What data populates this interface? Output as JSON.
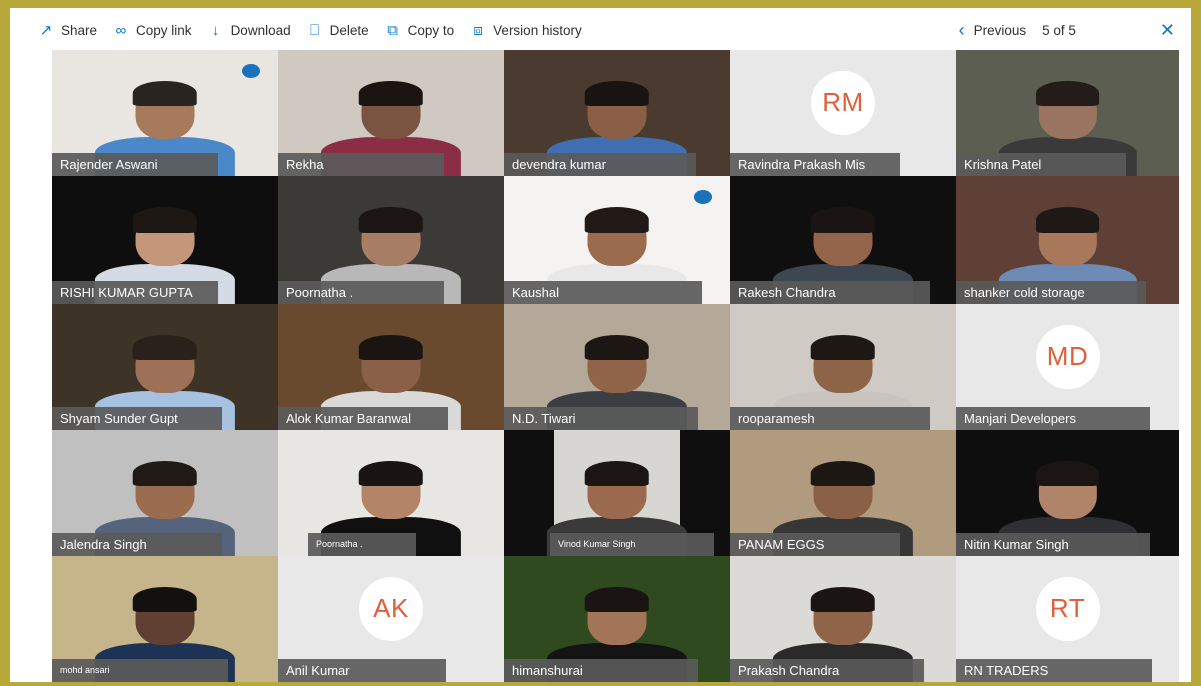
{
  "toolbar": {
    "items": [
      {
        "label": "Share",
        "icon": "share-icon"
      },
      {
        "label": "Copy link",
        "icon": "link-icon"
      },
      {
        "label": "Download",
        "icon": "download-icon"
      },
      {
        "label": "Delete",
        "icon": "trash-icon"
      },
      {
        "label": "Copy to",
        "icon": "copy-icon"
      },
      {
        "label": "Version history",
        "icon": "history-icon"
      }
    ],
    "previous_label": "Previous",
    "pager": "5 of 5"
  },
  "colors": {
    "accent": "#0078d4",
    "frame_border": "#b8a83a",
    "avatar_tile": "#e8e8e8",
    "avatar_text": "#e0603c",
    "name_label_bg": "#5a5a5a"
  },
  "participants": [
    {
      "name": "Rajender Aswani"
    },
    {
      "name": "Rekha"
    },
    {
      "name": "devendra kumar"
    },
    {
      "name": "Ravindra Prakash Mis",
      "initials": "RM"
    },
    {
      "name": "Krishna Patel"
    },
    {
      "name": "RISHI KUMAR GUPTA"
    },
    {
      "name": "Poornatha ."
    },
    {
      "name": "Kaushal"
    },
    {
      "name": "Rakesh Chandra"
    },
    {
      "name": "shanker cold storage"
    },
    {
      "name": "Shyam Sunder Gupt"
    },
    {
      "name": "Alok Kumar Baranwal"
    },
    {
      "name": "N.D. Tiwari"
    },
    {
      "name": "rooparamesh"
    },
    {
      "name": "Manjari Developers",
      "initials": "MD"
    },
    {
      "name": "Jalendra Singh"
    },
    {
      "name": "Poornatha ."
    },
    {
      "name": "Vinod Kumar Singh"
    },
    {
      "name": "PANAM EGGS"
    },
    {
      "name": "Nitin Kumar Singh"
    },
    {
      "name": "mohd ansari"
    },
    {
      "name": "Anil Kumar",
      "initials": "AK"
    },
    {
      "name": "himanshurai"
    },
    {
      "name": "Prakash Chandra"
    },
    {
      "name": "RN TRADERS",
      "initials": "RT"
    }
  ]
}
